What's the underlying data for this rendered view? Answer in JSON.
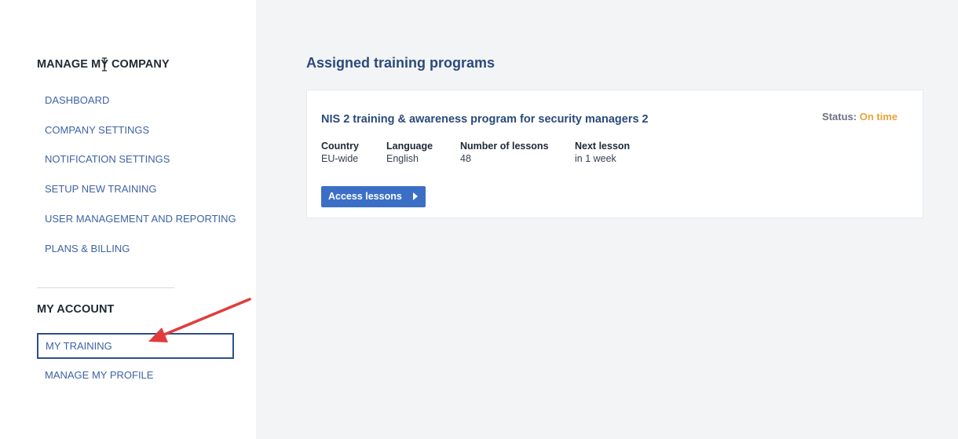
{
  "sidebar": {
    "company_heading": "MANAGE MY COMPANY",
    "company_items": [
      {
        "label": "DASHBOARD"
      },
      {
        "label": "COMPANY SETTINGS"
      },
      {
        "label": "NOTIFICATION SETTINGS"
      },
      {
        "label": "SETUP NEW TRAINING"
      },
      {
        "label": "USER MANAGEMENT AND REPORTING"
      },
      {
        "label": "PLANS & BILLING"
      }
    ],
    "account_heading": "MY ACCOUNT",
    "account_items": [
      {
        "label": "MY TRAINING",
        "active": true
      },
      {
        "label": "MANAGE MY PROFILE"
      }
    ]
  },
  "main": {
    "title": "Assigned training programs",
    "program": {
      "title": "NIS 2 training & awareness program for security managers 2",
      "status_label": "Status:",
      "status_value": "On time",
      "fields": [
        {
          "label": "Country",
          "value": "EU-wide"
        },
        {
          "label": "Language",
          "value": "English"
        },
        {
          "label": "Number of lessons",
          "value": "48"
        },
        {
          "label": "Next lesson",
          "value": "in 1 week"
        }
      ],
      "button_label": "Access lessons",
      "button_icon": "caret-right-icon"
    }
  },
  "colors": {
    "sidebar_bg": "#ffffff",
    "main_bg": "#f3f4f6",
    "nav_link": "#3e63a5",
    "title": "#2b4a7c",
    "status_ok": "#e9a23b",
    "button_bg": "#3b6fc6",
    "annotation_arrow": "#e03c3c"
  },
  "annotations": {
    "arrow": "red-arrow-pointing-to-my-training"
  }
}
